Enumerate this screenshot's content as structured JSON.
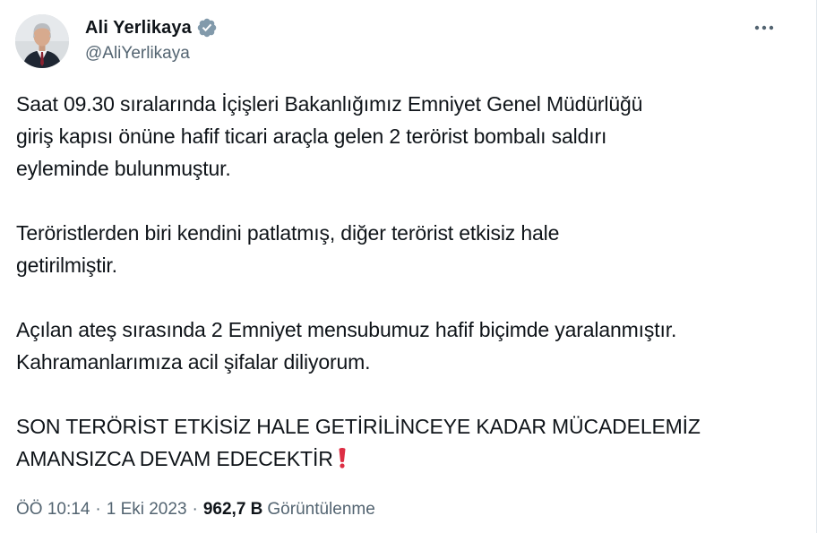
{
  "author": {
    "display_name": "Ali Yerlikaya",
    "handle": "@AliYerlikaya",
    "verified_color": "#829aab"
  },
  "tweet": {
    "paragraphs": [
      {
        "lines": [
          "Saat 09.30 sıralarında İçişleri Bakanlığımız Emniyet Genel Müdürlüğü",
          "giriş kapısı önüne hafif ticari araçla gelen 2 terörist bombalı saldırı",
          "eyleminde bulunmuştur."
        ]
      },
      {
        "lines": [
          "Teröristlerden biri kendini patlatmış, diğer terörist etkisiz hale",
          "getirilmiştir."
        ]
      },
      {
        "lines": [
          "Açılan ateş sırasında 2 Emniyet mensubumuz hafif biçimde yaralanmıştır.",
          "Kahramanlarımıza acil şifalar diliyorum."
        ]
      },
      {
        "lines": [
          "SON TERÖRİST ETKİSİZ HALE GETİRİLİNCEYE KADAR MÜCADELEMİZ",
          "AMANSIZCA DEVAM EDECEKTİR"
        ],
        "trailing_emoji": "red-exclamation-icon"
      }
    ],
    "time": "ÖÖ 10:14",
    "separator": "·",
    "date": "1 Eki 2023",
    "views_count": "962,7 B",
    "views_label": "Görüntülenme"
  },
  "colors": {
    "text": "#0f1419",
    "muted": "#536471",
    "emoji_red": "#dd2e44"
  },
  "icons": {
    "more": "more-dots-icon",
    "verified": "verified-badge-icon"
  }
}
